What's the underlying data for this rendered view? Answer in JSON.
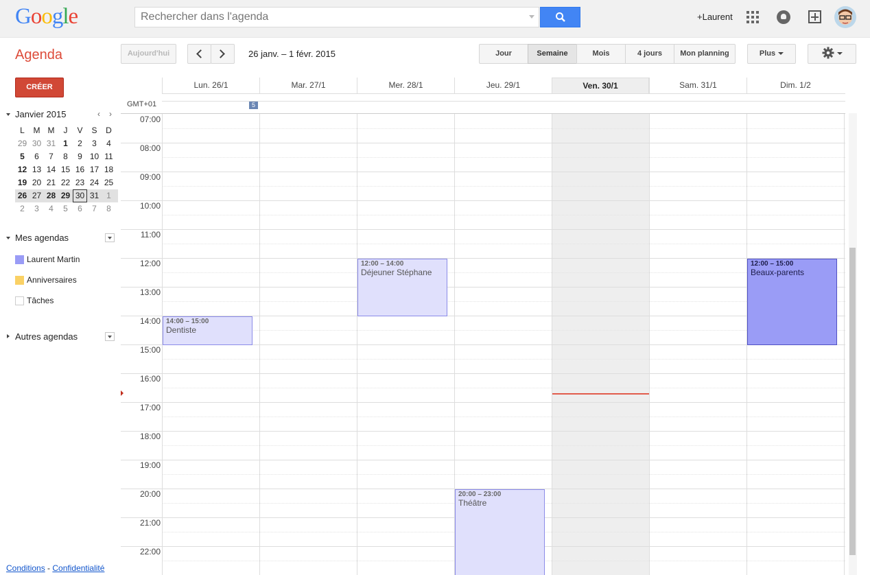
{
  "header": {
    "logo_letters": [
      "G",
      "o",
      "o",
      "g",
      "l",
      "e"
    ],
    "search_placeholder": "Rechercher dans l'agenda",
    "user_link": "+Laurent"
  },
  "toolbar": {
    "app_title": "Agenda",
    "today_label": "Aujourd'hui",
    "date_range": "26 janv. – 1 févr. 2015",
    "views": [
      "Jour",
      "Semaine",
      "Mois",
      "4 jours",
      "Mon planning"
    ],
    "active_view": "Semaine",
    "more_label": "Plus"
  },
  "sidebar": {
    "create_label": "CRÉER",
    "mini_calendar": {
      "month_label": "Janvier 2015",
      "prev": "‹",
      "next": "›",
      "weekdays": [
        "L",
        "M",
        "M",
        "J",
        "V",
        "S",
        "D"
      ],
      "weeks": [
        [
          "29",
          "30",
          "31",
          "1",
          "2",
          "3",
          "4"
        ],
        [
          "5",
          "6",
          "7",
          "8",
          "9",
          "10",
          "11"
        ],
        [
          "12",
          "13",
          "14",
          "15",
          "16",
          "17",
          "18"
        ],
        [
          "19",
          "20",
          "21",
          "22",
          "23",
          "24",
          "25"
        ],
        [
          "26",
          "27",
          "28",
          "29",
          "30",
          "31",
          "1"
        ],
        [
          "2",
          "3",
          "4",
          "5",
          "6",
          "7",
          "8"
        ]
      ]
    },
    "my_calendars_label": "Mes agendas",
    "my_calendars": [
      {
        "name": "Laurent Martin",
        "color": "#9a9cf6"
      },
      {
        "name": "Anniversaires",
        "color": "#fad165"
      },
      {
        "name": "Tâches",
        "color": "#ffffff"
      }
    ],
    "other_calendars_label": "Autres agendas",
    "footer": {
      "terms": "Conditions",
      "sep": " - ",
      "privacy": "Confidentialité"
    }
  },
  "calendar": {
    "timezone": "GMT+01",
    "allday_badge": "5",
    "days": [
      "Lun. 26/1",
      "Mar. 27/1",
      "Mer. 28/1",
      "Jeu. 29/1",
      "Ven. 30/1",
      "Sam. 31/1",
      "Dim. 1/2"
    ],
    "today_day": "Ven. 30/1",
    "hours": [
      "07:00",
      "08:00",
      "09:00",
      "10:00",
      "11:00",
      "12:00",
      "13:00",
      "14:00",
      "15:00",
      "16:00",
      "17:00",
      "18:00",
      "19:00",
      "20:00",
      "21:00",
      "22:00"
    ],
    "events": [
      {
        "day": "Lun. 26/1",
        "time": "14:00 – 15:00",
        "title": "Dentiste",
        "color": "#e0e0fc"
      },
      {
        "day": "Mer. 28/1",
        "time": "12:00 – 14:00",
        "title": "Déjeuner Stéphane",
        "color": "#e0e0fc"
      },
      {
        "day": "Jeu. 29/1",
        "time": "20:00 – 23:00",
        "title": "Théâtre",
        "color": "#e0e0fc"
      },
      {
        "day": "Dim. 1/2",
        "time": "12:00 – 15:00",
        "title": "Beaux-parents",
        "color": "#9a9cf6"
      }
    ]
  },
  "colors": {
    "accent_red": "#dd4b39",
    "create_red": "#d14836",
    "search_blue": "#4285f4",
    "now_line": "#e25c4c"
  }
}
